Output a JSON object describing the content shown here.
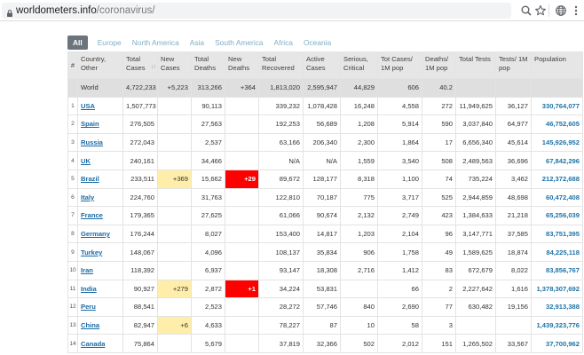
{
  "browser": {
    "url_domain": "worldometers.info",
    "url_path": "/coronavirus/"
  },
  "tabs": [
    {
      "label": "All",
      "active": true
    },
    {
      "label": "Europe",
      "active": false
    },
    {
      "label": "North America",
      "active": false
    },
    {
      "label": "Asia",
      "active": false
    },
    {
      "label": "South America",
      "active": false
    },
    {
      "label": "Africa",
      "active": false
    },
    {
      "label": "Oceania",
      "active": false
    }
  ],
  "table": {
    "columns": [
      {
        "key": "idx",
        "label": "#"
      },
      {
        "key": "country",
        "label": "Country, Other"
      },
      {
        "key": "total_cases",
        "label": "Total Cases"
      },
      {
        "key": "new_cases",
        "label": "New Cases"
      },
      {
        "key": "total_deaths",
        "label": "Total Deaths"
      },
      {
        "key": "new_deaths",
        "label": "New Deaths"
      },
      {
        "key": "total_recovered",
        "label": "Total Recovered"
      },
      {
        "key": "active_cases",
        "label": "Active Cases"
      },
      {
        "key": "serious",
        "label": "Serious, Critical"
      },
      {
        "key": "cases_per_1m",
        "label": "Tot Cases/ 1M pop"
      },
      {
        "key": "deaths_per_1m",
        "label": "Deaths/ 1M pop"
      },
      {
        "key": "total_tests",
        "label": "Total Tests"
      },
      {
        "key": "tests_per_1m",
        "label": "Tests/ 1M pop"
      },
      {
        "key": "population",
        "label": "Population"
      }
    ],
    "sort_indicator": "↓↑",
    "world": {
      "idx": "",
      "country": "World",
      "total_cases": "4,722,233",
      "new_cases": "+5,223",
      "total_deaths": "313,266",
      "new_deaths": "+364",
      "total_recovered": "1,813,020",
      "active_cases": "2,595,947",
      "serious": "44,829",
      "cases_per_1m": "606",
      "deaths_per_1m": "40.2",
      "total_tests": "",
      "tests_per_1m": "",
      "population": ""
    },
    "rows": [
      {
        "idx": "1",
        "country": "USA",
        "total_cases": "1,507,773",
        "new_cases": "",
        "total_deaths": "90,113",
        "new_deaths": "",
        "total_recovered": "339,232",
        "active_cases": "1,078,428",
        "serious": "16,248",
        "cases_per_1m": "4,558",
        "deaths_per_1m": "272",
        "total_tests": "11,949,625",
        "tests_per_1m": "36,127",
        "population": "330,764,077"
      },
      {
        "idx": "2",
        "country": "Spain",
        "total_cases": "276,505",
        "new_cases": "",
        "total_deaths": "27,563",
        "new_deaths": "",
        "total_recovered": "192,253",
        "active_cases": "56,689",
        "serious": "1,208",
        "cases_per_1m": "5,914",
        "deaths_per_1m": "590",
        "total_tests": "3,037,840",
        "tests_per_1m": "64,977",
        "population": "46,752,605"
      },
      {
        "idx": "3",
        "country": "Russia",
        "total_cases": "272,043",
        "new_cases": "",
        "total_deaths": "2,537",
        "new_deaths": "",
        "total_recovered": "63,166",
        "active_cases": "206,340",
        "serious": "2,300",
        "cases_per_1m": "1,864",
        "deaths_per_1m": "17",
        "total_tests": "6,656,340",
        "tests_per_1m": "45,614",
        "population": "145,926,952"
      },
      {
        "idx": "4",
        "country": "UK",
        "total_cases": "240,161",
        "new_cases": "",
        "total_deaths": "34,466",
        "new_deaths": "",
        "total_recovered": "N/A",
        "active_cases": "N/A",
        "serious": "1,559",
        "cases_per_1m": "3,540",
        "deaths_per_1m": "508",
        "total_tests": "2,489,563",
        "tests_per_1m": "36,696",
        "population": "67,842,296"
      },
      {
        "idx": "5",
        "country": "Brazil",
        "total_cases": "233,511",
        "new_cases": "+369",
        "total_deaths": "15,662",
        "new_deaths": "+29",
        "total_recovered": "89,672",
        "active_cases": "128,177",
        "serious": "8,318",
        "cases_per_1m": "1,100",
        "deaths_per_1m": "74",
        "total_tests": "735,224",
        "tests_per_1m": "3,462",
        "population": "212,372,688"
      },
      {
        "idx": "6",
        "country": "Italy",
        "total_cases": "224,760",
        "new_cases": "",
        "total_deaths": "31,763",
        "new_deaths": "",
        "total_recovered": "122,810",
        "active_cases": "70,187",
        "serious": "775",
        "cases_per_1m": "3,717",
        "deaths_per_1m": "525",
        "total_tests": "2,944,859",
        "tests_per_1m": "48,698",
        "population": "60,472,408"
      },
      {
        "idx": "7",
        "country": "France",
        "total_cases": "179,365",
        "new_cases": "",
        "total_deaths": "27,625",
        "new_deaths": "",
        "total_recovered": "61,066",
        "active_cases": "90,674",
        "serious": "2,132",
        "cases_per_1m": "2,749",
        "deaths_per_1m": "423",
        "total_tests": "1,384,633",
        "tests_per_1m": "21,218",
        "population": "65,256,039"
      },
      {
        "idx": "8",
        "country": "Germany",
        "total_cases": "176,244",
        "new_cases": "",
        "total_deaths": "8,027",
        "new_deaths": "",
        "total_recovered": "153,400",
        "active_cases": "14,817",
        "serious": "1,203",
        "cases_per_1m": "2,104",
        "deaths_per_1m": "96",
        "total_tests": "3,147,771",
        "tests_per_1m": "37,585",
        "population": "83,751,395"
      },
      {
        "idx": "9",
        "country": "Turkey",
        "total_cases": "148,067",
        "new_cases": "",
        "total_deaths": "4,096",
        "new_deaths": "",
        "total_recovered": "108,137",
        "active_cases": "35,834",
        "serious": "906",
        "cases_per_1m": "1,758",
        "deaths_per_1m": "49",
        "total_tests": "1,589,625",
        "tests_per_1m": "18,874",
        "population": "84,225,118"
      },
      {
        "idx": "10",
        "country": "Iran",
        "total_cases": "118,392",
        "new_cases": "",
        "total_deaths": "6,937",
        "new_deaths": "",
        "total_recovered": "93,147",
        "active_cases": "18,308",
        "serious": "2,716",
        "cases_per_1m": "1,412",
        "deaths_per_1m": "83",
        "total_tests": "672,679",
        "tests_per_1m": "8,022",
        "population": "83,856,767"
      },
      {
        "idx": "11",
        "country": "India",
        "total_cases": "90,927",
        "new_cases": "+279",
        "total_deaths": "2,872",
        "new_deaths": "+1",
        "total_recovered": "34,224",
        "active_cases": "53,831",
        "serious": "",
        "cases_per_1m": "66",
        "deaths_per_1m": "2",
        "total_tests": "2,227,642",
        "tests_per_1m": "1,616",
        "population": "1,378,307,692"
      },
      {
        "idx": "12",
        "country": "Peru",
        "total_cases": "88,541",
        "new_cases": "",
        "total_deaths": "2,523",
        "new_deaths": "",
        "total_recovered": "28,272",
        "active_cases": "57,746",
        "serious": "840",
        "cases_per_1m": "2,690",
        "deaths_per_1m": "77",
        "total_tests": "630,482",
        "tests_per_1m": "19,156",
        "population": "32,913,388"
      },
      {
        "idx": "13",
        "country": "China",
        "total_cases": "82,947",
        "new_cases": "+6",
        "total_deaths": "4,633",
        "new_deaths": "",
        "total_recovered": "78,227",
        "active_cases": "87",
        "serious": "10",
        "cases_per_1m": "58",
        "deaths_per_1m": "3",
        "total_tests": "",
        "tests_per_1m": "",
        "population": "1,439,323,776"
      },
      {
        "idx": "14",
        "country": "Canada",
        "total_cases": "75,864",
        "new_cases": "",
        "total_deaths": "5,679",
        "new_deaths": "",
        "total_recovered": "37,819",
        "active_cases": "32,366",
        "serious": "502",
        "cases_per_1m": "2,012",
        "deaths_per_1m": "151",
        "total_tests": "1,265,502",
        "tests_per_1m": "33,567",
        "population": "37,700,962"
      }
    ]
  },
  "colors": {
    "new_cases_highlight": "#ffeeaa",
    "new_deaths_highlight": "#ff0000",
    "country_link": "#1a6aa5",
    "tab_active": "#6c757d",
    "tab_inactive_text": "#7eaec7"
  },
  "icons": {
    "lock": "lock-icon",
    "zoom": "zoom-icon",
    "bookmark": "star-icon",
    "globe": "globe-icon",
    "menu": "kebab-menu-icon"
  }
}
